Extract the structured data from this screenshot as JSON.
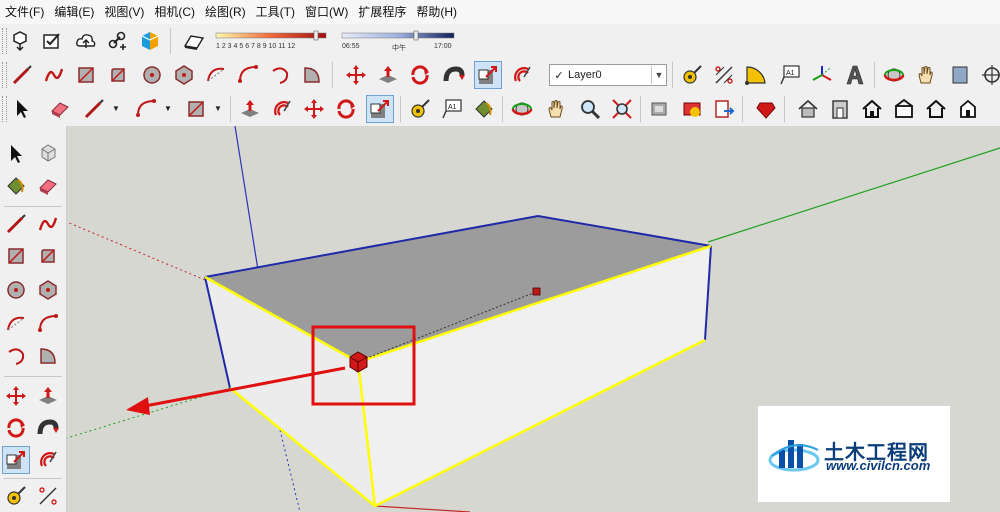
{
  "menu": [
    "文件(F)",
    "编辑(E)",
    "视图(V)",
    "相机(C)",
    "绘图(R)",
    "工具(T)",
    "窗口(W)",
    "扩展程序",
    "帮助(H)"
  ],
  "shadow": {
    "hour_ticks": "1 2 3 4 5 6 7 8 9 10 11 12",
    "time_start": "06:55",
    "time_mid": "中午",
    "time_end": "17:00"
  },
  "layer": {
    "name": "Layer0",
    "check": "✓"
  },
  "colors": {
    "axis_blue": "#2a34b8",
    "axis_green": "#1ea21e",
    "axis_red": "#c22828",
    "highlight": "#ffff00",
    "annotation": "#e01010"
  },
  "watermark": {
    "title": "土木工程网",
    "url": "www.civilcn.com"
  },
  "model_label": "A1"
}
